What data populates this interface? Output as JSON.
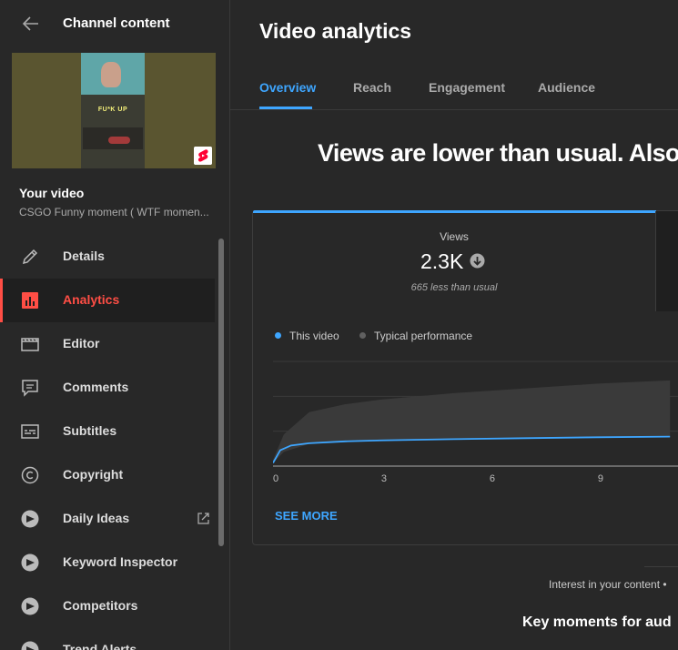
{
  "sidebar": {
    "back_icon": "arrow-left-icon",
    "title": "Channel content",
    "video_label": "Your video",
    "video_title": "CSGO Funny moment ( WTF momen...",
    "thumbnail_caption": "FU*K UP",
    "items": [
      {
        "label": "Details",
        "icon": "pencil-icon"
      },
      {
        "label": "Analytics",
        "icon": "analytics-icon",
        "active": true
      },
      {
        "label": "Editor",
        "icon": "clapperboard-icon"
      },
      {
        "label": "Comments",
        "icon": "comment-icon"
      },
      {
        "label": "Subtitles",
        "icon": "subtitles-icon"
      },
      {
        "label": "Copyright",
        "icon": "copyright-icon"
      },
      {
        "label": "Daily Ideas",
        "icon": "vidiq-icon",
        "external": true
      },
      {
        "label": "Keyword Inspector",
        "icon": "vidiq-icon"
      },
      {
        "label": "Competitors",
        "icon": "vidiq-icon"
      },
      {
        "label": "Trend Alerts",
        "icon": "vidiq-icon"
      }
    ]
  },
  "main": {
    "title": "Video analytics",
    "tabs": [
      "Overview",
      "Reach",
      "Engagement",
      "Audience"
    ],
    "active_tab": "Overview",
    "headline": "Views are lower than usual. Also",
    "card": {
      "stat_label": "Views",
      "stat_value": "2.3K",
      "stat_trend_icon": "arrow-down-circle-icon",
      "stat_sub": "665 less than usual",
      "legend": [
        {
          "label": "This video",
          "color": "#3ea6ff"
        },
        {
          "label": "Typical performance",
          "color": "#606060"
        }
      ],
      "see_more": "SEE MORE"
    },
    "interest_text": "Interest in your content •",
    "key_moments": "Key moments for aud"
  },
  "colors": {
    "accent": "#3ea6ff",
    "active_nav": "#ff4e45",
    "background": "#282828"
  },
  "chart_data": {
    "type": "area",
    "x_ticks": [
      "0",
      "3",
      "6",
      "9"
    ],
    "series": [
      {
        "name": "This video",
        "x": [
          0,
          0.2,
          0.5,
          1,
          2,
          3,
          5,
          7,
          9,
          11
        ],
        "y": [
          0.1,
          0.5,
          0.65,
          0.72,
          0.78,
          0.81,
          0.85,
          0.88,
          0.91,
          0.93
        ]
      },
      {
        "name": "Typical performance",
        "x": [
          0,
          0.3,
          1,
          2,
          3,
          5,
          7,
          9,
          11
        ],
        "y_low": [
          0.1,
          0.45,
          0.7,
          0.78,
          0.82,
          0.86,
          0.89,
          0.91,
          0.92
        ],
        "y_high": [
          0.2,
          1.0,
          1.7,
          1.95,
          2.1,
          2.3,
          2.45,
          2.6,
          2.7
        ]
      }
    ],
    "ylim": [
      0,
      3.3
    ],
    "xlim": [
      0,
      11.6
    ],
    "grid": true
  }
}
